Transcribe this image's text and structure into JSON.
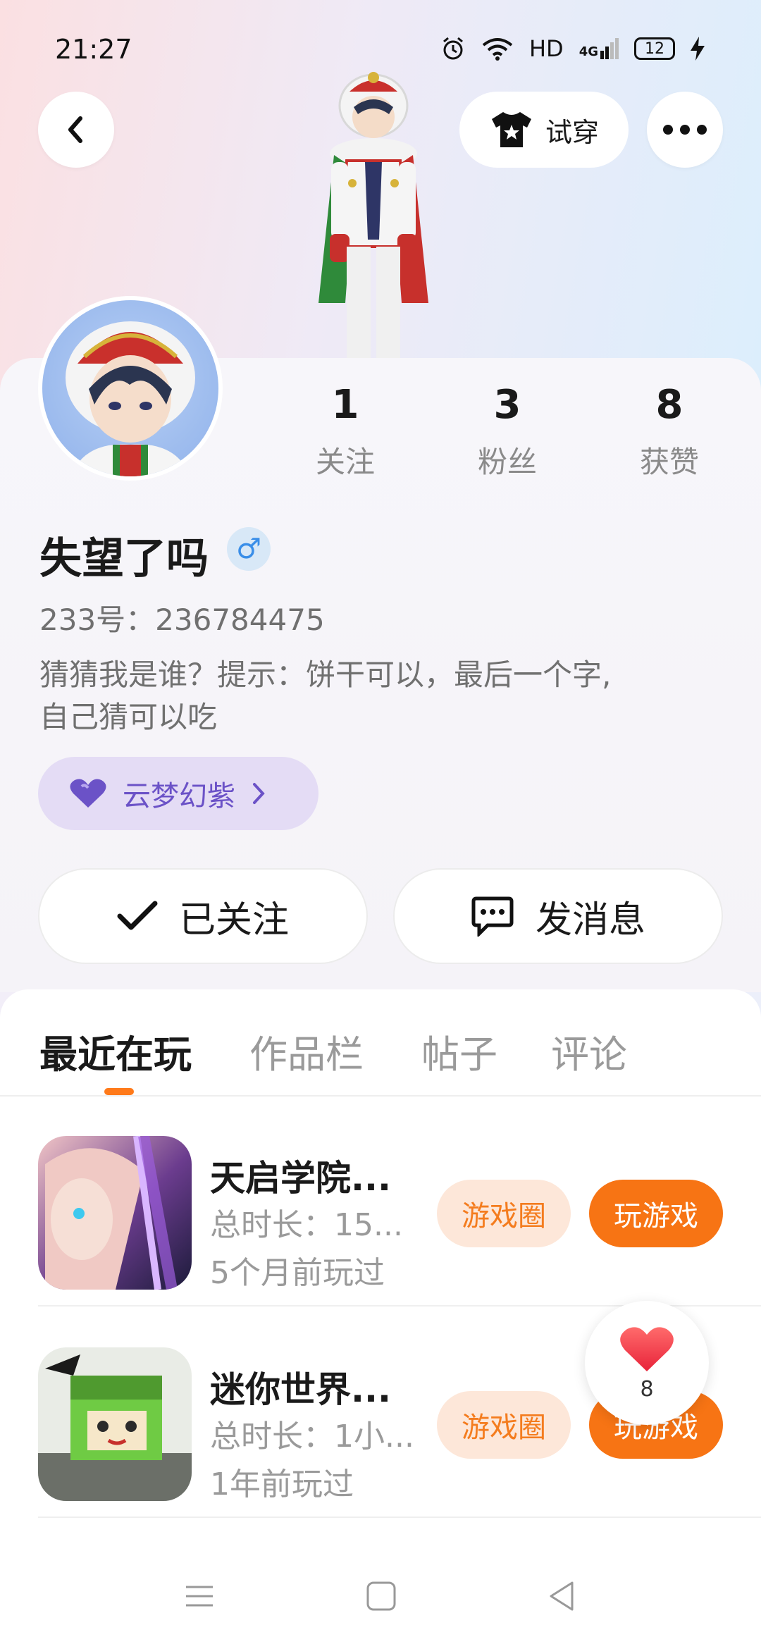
{
  "status_bar": {
    "time": "21:27",
    "network": "HD",
    "signal": "4G",
    "battery": "12"
  },
  "header": {
    "tryon_label": "试穿"
  },
  "profile": {
    "stats": [
      {
        "value": "1",
        "label": "关注"
      },
      {
        "value": "3",
        "label": "粉丝"
      },
      {
        "value": "8",
        "label": "获赞"
      }
    ],
    "nickname": "失望了吗",
    "gender_symbol": "♂",
    "user_id": "233号：236784475",
    "bio_line1": "猜猜我是谁？提示：饼干可以，最后一个字,",
    "bio_line2": "自己猜可以吃",
    "badge": "云梦幻紫",
    "follow_label": "已关注",
    "message_label": "发消息"
  },
  "tabs": [
    {
      "label": "最近在玩"
    },
    {
      "label": "作品栏"
    },
    {
      "label": "帖子"
    },
    {
      "label": "评论"
    }
  ],
  "games": [
    {
      "title": "天启学院...",
      "duration": "总时长：15...",
      "last_played": "5个月前玩过",
      "circle_label": "游戏圈",
      "play_label": "玩游戏"
    },
    {
      "title": "迷你世界...",
      "duration": "总时长：1小...",
      "last_played": "1年前玩过",
      "circle_label": "游戏圈",
      "play_label": "玩游戏"
    }
  ],
  "floating_like": {
    "count": "8"
  },
  "colors": {
    "accent": "#f77414",
    "accent_light": "#fde7d9",
    "badge_purple": "#6b52c7",
    "gender_blue": "#3a8ee8"
  },
  "icons": {
    "back": "chevron-left-icon",
    "tryon": "shirt-icon",
    "more": "more-dots-icon",
    "follow_check": "check-icon",
    "message": "chat-bubble-icon",
    "badge": "heart-icon",
    "like": "heart-icon"
  }
}
